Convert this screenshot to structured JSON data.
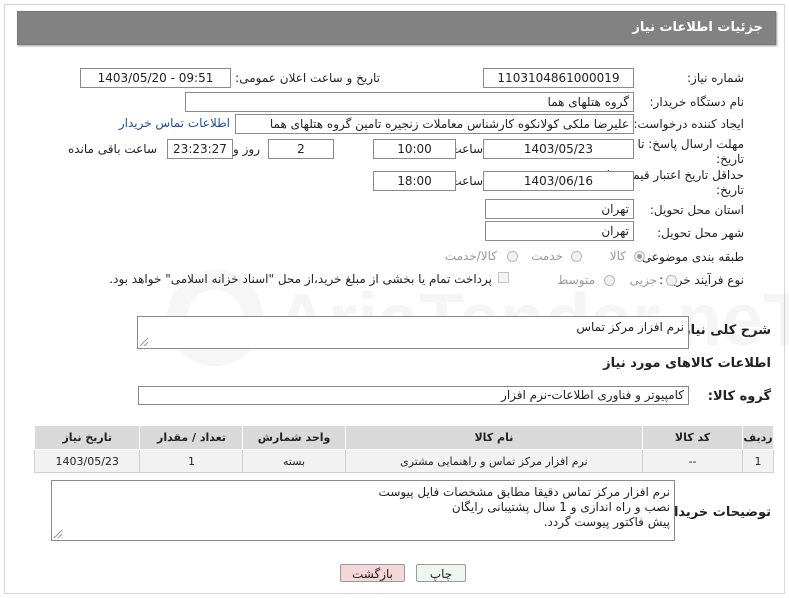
{
  "header": {
    "title": "جزئیات اطلاعات نیاز"
  },
  "form": {
    "need_number_label": "شماره نیاز:",
    "need_number": "1103104861000019",
    "announce_label": "تاریخ و ساعت اعلان عمومی:",
    "announce_value": "1403/05/20 - 09:51",
    "buyer_org_label": "نام دستگاه خریدار:",
    "buyer_org": "گروه هتلهای هما",
    "creator_label": "ایجاد کننده درخواست:",
    "creator": "علیرضا ملکی کولانکوه کارشناس معاملات زنجیره تامین گروه هتلهای هما",
    "contact_link": "اطلاعات تماس خریدار",
    "deadline_label_1": "مهلت ارسال پاسخ: تا",
    "deadline_label_2": "تاریخ:",
    "deadline_date": "1403/05/23",
    "time_label": "ساعت",
    "deadline_time": "10:00",
    "days_value": "2",
    "days_label": "روز و",
    "remaining_time": "23:23:27",
    "remaining_label": "ساعت باقی مانده",
    "validity_label_1": "حداقل تاریخ اعتبار قیمت: تا",
    "validity_label_2": "تاریخ:",
    "validity_date": "1403/06/16",
    "validity_time_label": "ساعت",
    "validity_time": "18:00",
    "province_label": "استان محل تحویل:",
    "province": "تهران",
    "city_label": "شهر محل تحویل:",
    "city": "تهران",
    "category_label": "طبقه بندی موضوعی:",
    "category_options": [
      "کالا",
      "خدمت",
      "کالا/خدمت"
    ],
    "process_label": "نوع فرآیند خرید :",
    "process_options": [
      "جزیی",
      "متوسط"
    ],
    "payment_note": "پرداخت تمام یا بخشی از مبلغ خرید،از محل \"اسناد خزانه اسلامی\" خواهد بود."
  },
  "description": {
    "label": "شرح کلی نیاز:",
    "value": "نرم افزار مرکز تماس"
  },
  "goods_section": {
    "title": "اطلاعات کالاهای مورد نیاز",
    "group_label": "گروه کالا:",
    "group_value": "کامپیوتر و فناوری اطلاعات-نرم افزار"
  },
  "table": {
    "headers": [
      "ردیف",
      "کد کالا",
      "نام کالا",
      "واحد شمارش",
      "تعداد / مقدار",
      "تاریخ نیاز"
    ],
    "rows": [
      [
        "1",
        "--",
        "نرم افزار مرکز تماس و راهنمایی مشتری",
        "بسته",
        "1",
        "1403/05/23"
      ]
    ]
  },
  "buyer_notes": {
    "label": "توضیحات خریدار:",
    "lines": [
      "نرم افزار مرکز تماس دقیقا مطابق مشخصات فایل پیوست",
      "نصب و راه اندازی و 1 سال پشتیبانی رایگان",
      "پیش فاکتور پیوست گردد."
    ]
  },
  "buttons": {
    "print": "چاپ",
    "back": "بازگشت"
  },
  "watermark": {
    "text": "AriaTender.neT"
  },
  "colors": {
    "header_bg": "#828282",
    "back_button_bg": "#f6d7d7",
    "print_button_bg": "#eef7ee"
  }
}
